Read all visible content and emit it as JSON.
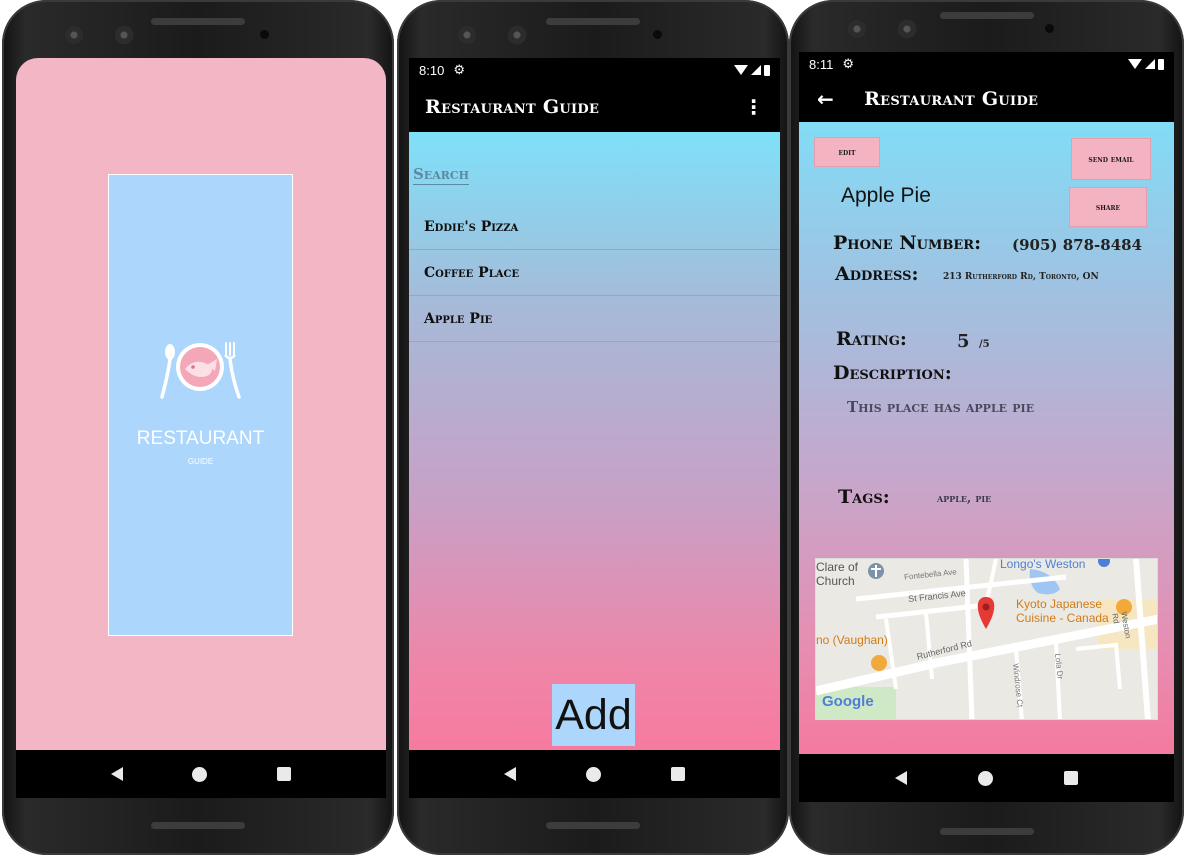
{
  "splash": {
    "title": "RESTAURANT",
    "subtitle": "GUIDE"
  },
  "list_screen": {
    "status_time": "8:10",
    "app_title": "Restaurant Guide",
    "search_label": "Search",
    "items": [
      {
        "label": "Eddie's Pizza"
      },
      {
        "label": "Coffee Place"
      },
      {
        "label": "Apple Pie"
      }
    ],
    "add_label": "Add"
  },
  "detail_screen": {
    "status_time": "8:11",
    "app_title": "Restaurant Guide",
    "edit_label": "edit",
    "send_email_label": "send email",
    "share_label": "share",
    "name": "Apple Pie",
    "phone_label": "Phone Number:",
    "phone_value": "(905) 878-8484",
    "address_label": "Address:",
    "address_value": "213 Rutherford Rd, Toronto, ON",
    "rating_label": "Rating:",
    "rating_value": "5",
    "rating_max": "/5",
    "description_label": "Description:",
    "description_value": "This place has apple pie",
    "tags_label": "Tags:",
    "tags_value": "apple, pie",
    "map": {
      "labels": {
        "church": "Clare of Church",
        "longos": "Longo's Weston",
        "fontebella": "Fontebella Ave",
        "st_francis": "St Francis Ave",
        "kyoto": "Kyoto Japanese Cuisine - Canada",
        "weston_rd": "Weston Rd",
        "vaughan": "no (Vaughan)",
        "rutherford": "Rutherford Rd",
        "windrose": "Windrose Ct",
        "lola": "Lola Dr",
        "google": "Google"
      }
    }
  },
  "colors": {
    "splash_pink": "#f3b6c4",
    "splash_blue": "#acd6fb",
    "gradient_top": "#7fe0f9",
    "gradient_bottom": "#f77aa0",
    "button_pink": "#f4b3c1",
    "map_pin": "#e53935"
  }
}
